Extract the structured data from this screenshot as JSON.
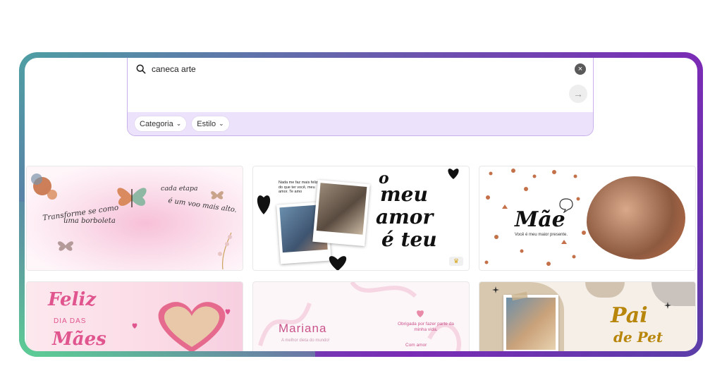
{
  "search": {
    "query": "caneca arte",
    "clear_symbol": "×",
    "submit_symbol": "→",
    "filters": [
      {
        "label": "Categoria"
      },
      {
        "label": "Estilo"
      }
    ]
  },
  "templates": [
    {
      "lines": [
        "Transforme se como",
        "uma borboleta",
        "cada etapa",
        "é um voo mais alto."
      ]
    },
    {
      "note": "Nada me faz mais feliz do que ter você, meu amor. Te amo",
      "title_lines": [
        "o",
        "meu",
        "amor",
        "é teu"
      ],
      "badge": "♛"
    },
    {
      "title": "Mãe",
      "subtitle": "Você é meu maior presente."
    },
    {
      "title_lines": [
        "Feliz",
        "DIA DAS",
        "Mães"
      ]
    },
    {
      "name": "Mariana",
      "tagline": "A melhor dieta do mundo!",
      "message": "Obrigada por fazer parte da minha vida.",
      "sign": "Com amor"
    },
    {
      "title_lines": [
        "Pai",
        "de Pet"
      ]
    }
  ],
  "colors": {
    "frame_gradient": [
      "#4e9fa3",
      "#7a2bb5",
      "#5ccf94"
    ],
    "filter_bar": "#ece2fb",
    "accent_pink": "#e0558e",
    "accent_brown": "#c4714a"
  }
}
